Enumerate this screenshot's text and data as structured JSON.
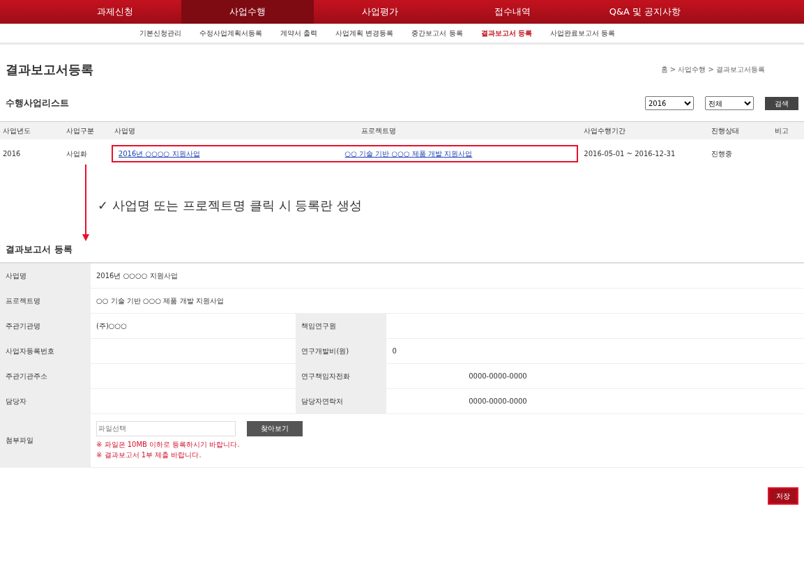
{
  "top_nav": [
    {
      "label": "과제신청",
      "selected": false
    },
    {
      "label": "사업수행",
      "selected": true
    },
    {
      "label": "사업평가",
      "selected": false
    },
    {
      "label": "접수내역",
      "selected": false
    },
    {
      "label": "Q&A 및 공지사항",
      "selected": false
    }
  ],
  "sub_nav": [
    {
      "label": "기본신청관리",
      "selected": false
    },
    {
      "label": "수정사업계획서등록",
      "selected": false
    },
    {
      "label": "계약서 출력",
      "selected": false
    },
    {
      "label": "사업계획 변경등록",
      "selected": false
    },
    {
      "label": "중간보고서 등록",
      "selected": false
    },
    {
      "label": "결과보고서 등록",
      "selected": true
    },
    {
      "label": "사업완료보고서 등록",
      "selected": false
    }
  ],
  "page_title": "결과보고서등록",
  "breadcrumb": "홈 > 사업수행 > 결과보고서등록",
  "list": {
    "title": "수행사업리스트",
    "filters": [
      "2016",
      "전체"
    ],
    "search_button": "검색",
    "columns": [
      "사업년도",
      "사업구분",
      "사업명",
      "프로젝트명",
      "사업수행기간",
      "진행상태",
      "비고"
    ],
    "rows": [
      {
        "year": "2016",
        "type": "사업화",
        "name": "2016년 ○○○○ 지원사업",
        "project": "○○ 기술 기반 ○○○ 제품 개발 지원사업",
        "period": "2016-05-01 ~ 2016-12-31",
        "status": "진행중"
      }
    ]
  },
  "annotation": "✓ 사업명 또는 프로젝트명 클릭 시 등록란 생성",
  "form": {
    "title": "결과보고서 등록",
    "rows": [
      {
        "kind": "wide",
        "label": "사업명",
        "value": "2016년 ○○○○ 지원사업"
      },
      {
        "kind": "wide",
        "label": "프로젝트명",
        "value": "○○ 기술 기반 ○○○ 제품 개발 지원사업"
      },
      {
        "kind": "pair",
        "label": "주관기관명",
        "value": "(주)○○○",
        "label2": "책임연구원",
        "value2": ""
      },
      {
        "kind": "pair",
        "label": "사업자등록번호",
        "value": "",
        "label2": "연구개발비(원)",
        "value2": "0"
      },
      {
        "kind": "pair",
        "label": "주관기관주소",
        "value": "",
        "label2": "연구책임자전화",
        "value2": "",
        "extra": "0000-0000-0000"
      },
      {
        "kind": "pair",
        "label": "담당자",
        "value": "",
        "label2": "담당자연락처",
        "value2": "",
        "extra": "0000-0000-0000"
      },
      {
        "kind": "file",
        "label": "첨부파일",
        "placeholder": "파일선택",
        "button": "찾아보기",
        "notes": [
          "※ 파일은 10MB 이하로 등록하시기 바랍니다.",
          "※ 결과보고서 1부 제출 바랍니다."
        ]
      }
    ]
  },
  "save_button": "저장"
}
